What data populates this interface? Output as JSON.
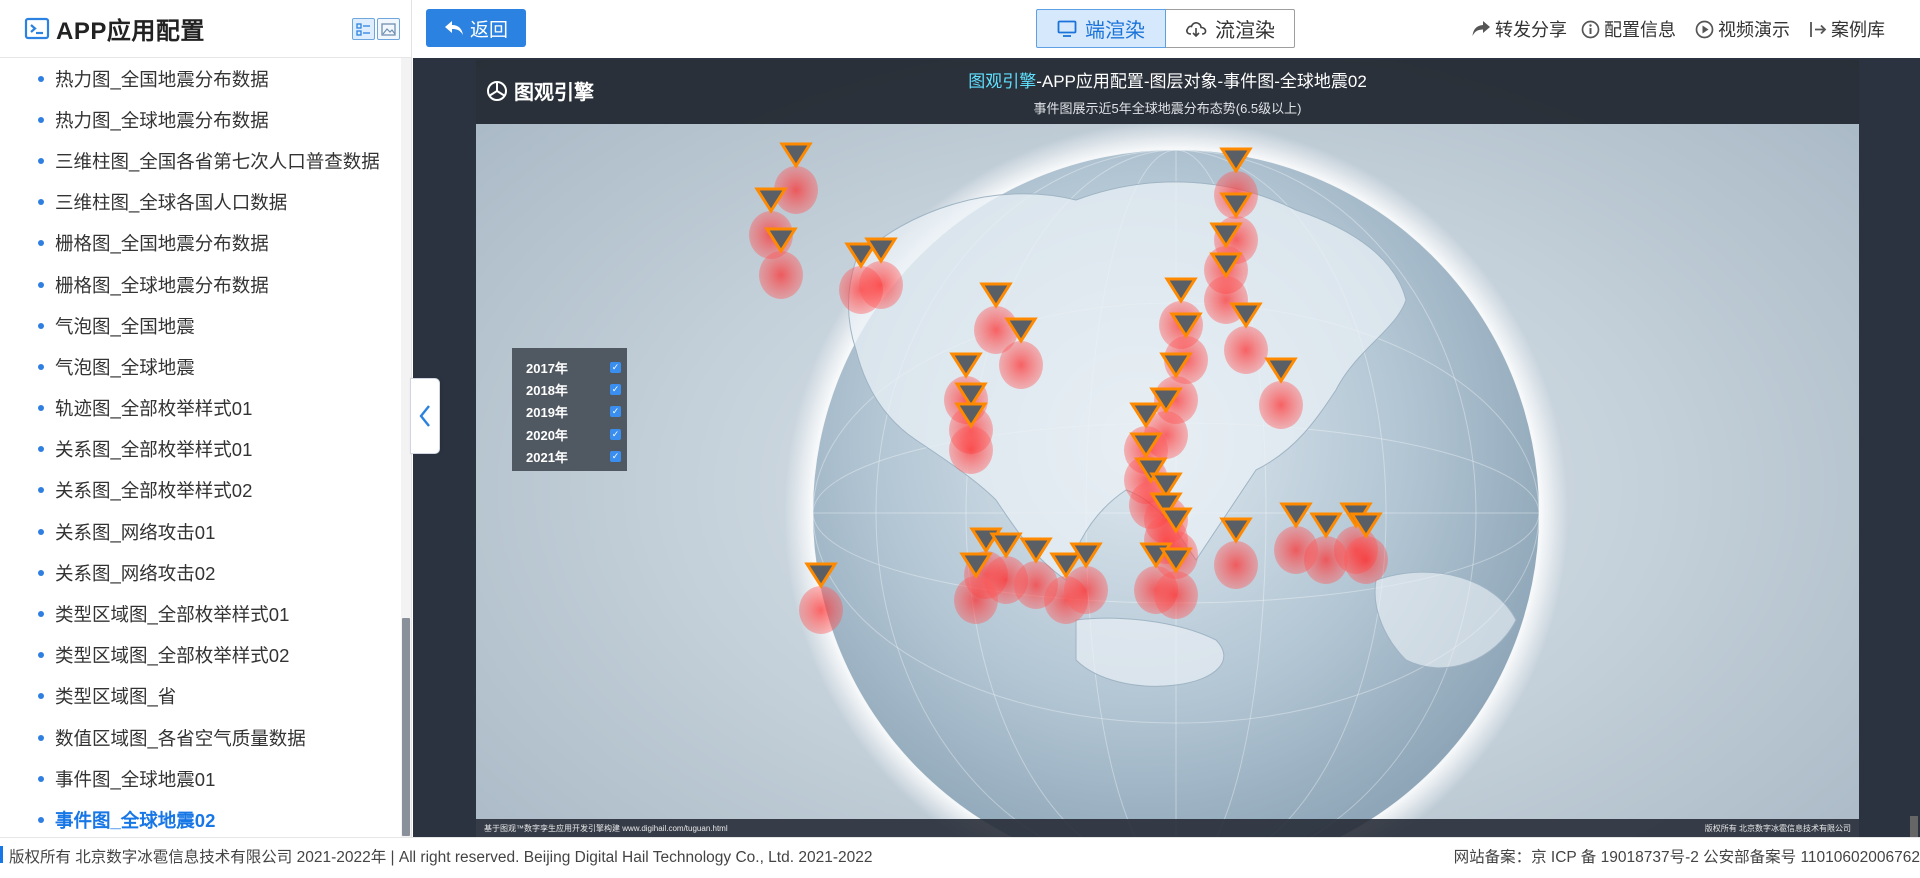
{
  "sidebar": {
    "title": "APP应用配置",
    "items": [
      {
        "label": "热力图_全国地震分布数据"
      },
      {
        "label": "热力图_全球地震分布数据"
      },
      {
        "label": "三维柱图_全国各省第七次人口普查数据"
      },
      {
        "label": "三维柱图_全球各国人口数据"
      },
      {
        "label": "栅格图_全国地震分布数据"
      },
      {
        "label": "栅格图_全球地震分布数据"
      },
      {
        "label": "气泡图_全国地震"
      },
      {
        "label": "气泡图_全球地震"
      },
      {
        "label": "轨迹图_全部枚举样式01"
      },
      {
        "label": "关系图_全部枚举样式01"
      },
      {
        "label": "关系图_全部枚举样式02"
      },
      {
        "label": "关系图_网络攻击01"
      },
      {
        "label": "关系图_网络攻击02"
      },
      {
        "label": "类型区域图_全部枚举样式01"
      },
      {
        "label": "类型区域图_全部枚举样式02"
      },
      {
        "label": "类型区域图_省"
      },
      {
        "label": "数值区域图_各省空气质量数据"
      },
      {
        "label": "事件图_全球地震01"
      },
      {
        "label": "事件图_全球地震02",
        "active": true
      }
    ]
  },
  "toolbar": {
    "back_label": "返回",
    "endpoint_render_label": "端渲染",
    "stream_render_label": "流渲染",
    "share_label": "转发分享",
    "config_info_label": "配置信息",
    "video_demo_label": "视频演示",
    "case_library_label": "案例库"
  },
  "scene": {
    "brand": "图观引擎",
    "title_brand": "图观引擎",
    "title_rest": "-APP应用配置-图层对象-事件图-全球地震02",
    "subtitle": "事件图展示近5年全球地震分布态势(6.5级以上)",
    "legend": [
      {
        "label": "2017年",
        "checked": true
      },
      {
        "label": "2018年",
        "checked": true
      },
      {
        "label": "2019年",
        "checked": true
      },
      {
        "label": "2020年",
        "checked": true
      },
      {
        "label": "2021年",
        "checked": true
      }
    ],
    "footer_left": "基于图观™数字孪生应用开发引擎构建 www.digihail.com/tuguan.html",
    "footer_right": "版权所有 北京数字冰雹信息技术有限公司",
    "accent_color": "#ff3b3b",
    "marker_color": "#ff8a00"
  },
  "footer": {
    "copyright": "版权所有 北京数字冰雹信息技术有限公司 2021-2022年 | All right reserved. Beijing Digital Hail Technology Co., Ltd. 2021-2022",
    "icp": "网站备案：京 ICP 备 19018737号-2 公安部备案号 11010602006762"
  },
  "colors": {
    "primary": "#2b82e0",
    "active_text": "#1877e6"
  }
}
